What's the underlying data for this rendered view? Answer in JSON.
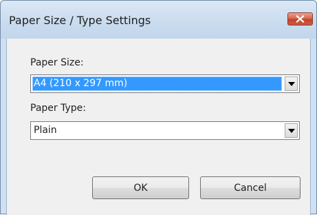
{
  "window": {
    "title": "Paper Size / Type Settings",
    "close_icon": "close-x-icon"
  },
  "paper_size": {
    "label": "Paper Size:",
    "value": "A4 (210 x 297 mm)",
    "dropdown_icon": "chevron-down-icon"
  },
  "paper_type": {
    "label": "Paper Type:",
    "value": "Plain",
    "dropdown_icon": "chevron-down-icon"
  },
  "buttons": {
    "ok_label": "OK",
    "cancel_label": "Cancel"
  },
  "colors": {
    "selection": "#3399ff",
    "close_button": "#c7432d",
    "title_bar": "#c9dbee",
    "dialog_background": "#f0f0f0"
  }
}
